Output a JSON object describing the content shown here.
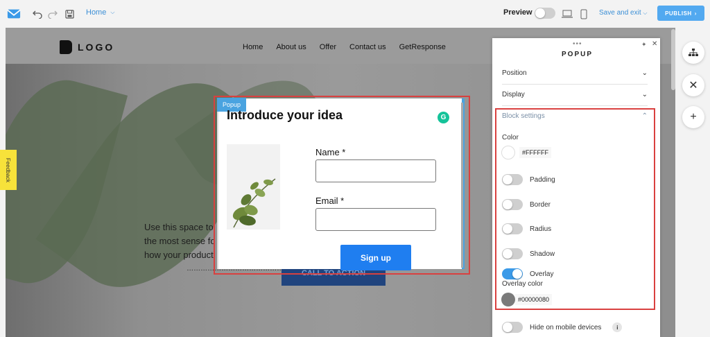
{
  "topbar": {
    "page_label": "Home",
    "preview_label": "Preview",
    "save_exit_label": "Save and exit",
    "publish_label": "PUBLISH"
  },
  "site": {
    "logo_text": "LOGO",
    "nav": [
      "Home",
      "About us",
      "Offer",
      "Contact us",
      "GetResponse"
    ],
    "hero_text_lines": [
      "Use this space to                                                   ation th",
      "the most sense fo                                                  Cr, brie",
      "how your product                                                  go. Cus",
      "                      ……………………………………………………"
    ],
    "cta_label": "CALL TO ACTION"
  },
  "popup": {
    "tag": "Popup",
    "title": "Introduce your idea",
    "grammarly_icon": "G",
    "name_label": "Name *",
    "email_label": "Email *",
    "signup_label": "Sign up"
  },
  "panel": {
    "title": "POPUP",
    "sections": {
      "position": "Position",
      "display": "Display",
      "block_settings": "Block settings"
    },
    "color_label": "Color",
    "color_value": "#FFFFFF",
    "options": {
      "padding": "Padding",
      "border": "Border",
      "radius": "Radius",
      "shadow": "Shadow",
      "overlay": "Overlay"
    },
    "overlay_color_label": "Overlay color",
    "overlay_color_value": "#00000080",
    "hide_mobile": "Hide on mobile devices",
    "info_icon": "i"
  },
  "feedback_label": "Feedback"
}
